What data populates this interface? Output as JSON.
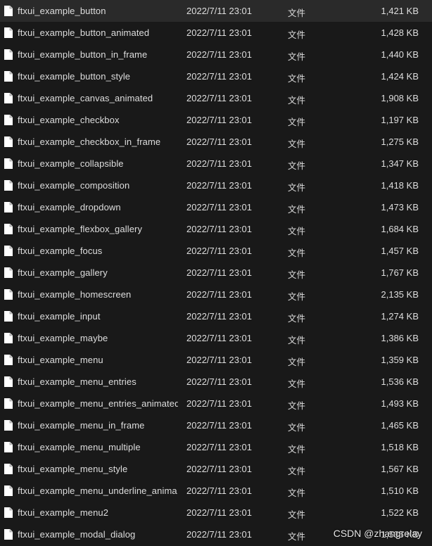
{
  "files": [
    {
      "name": "ftxui_example_button",
      "date": "2022/7/11 23:01",
      "type": "文件",
      "size": "1,421 KB"
    },
    {
      "name": "ftxui_example_button_animated",
      "date": "2022/7/11 23:01",
      "type": "文件",
      "size": "1,428 KB"
    },
    {
      "name": "ftxui_example_button_in_frame",
      "date": "2022/7/11 23:01",
      "type": "文件",
      "size": "1,440 KB"
    },
    {
      "name": "ftxui_example_button_style",
      "date": "2022/7/11 23:01",
      "type": "文件",
      "size": "1,424 KB"
    },
    {
      "name": "ftxui_example_canvas_animated",
      "date": "2022/7/11 23:01",
      "type": "文件",
      "size": "1,908 KB"
    },
    {
      "name": "ftxui_example_checkbox",
      "date": "2022/7/11 23:01",
      "type": "文件",
      "size": "1,197 KB"
    },
    {
      "name": "ftxui_example_checkbox_in_frame",
      "date": "2022/7/11 23:01",
      "type": "文件",
      "size": "1,275 KB"
    },
    {
      "name": "ftxui_example_collapsible",
      "date": "2022/7/11 23:01",
      "type": "文件",
      "size": "1,347 KB"
    },
    {
      "name": "ftxui_example_composition",
      "date": "2022/7/11 23:01",
      "type": "文件",
      "size": "1,418 KB"
    },
    {
      "name": "ftxui_example_dropdown",
      "date": "2022/7/11 23:01",
      "type": "文件",
      "size": "1,473 KB"
    },
    {
      "name": "ftxui_example_flexbox_gallery",
      "date": "2022/7/11 23:01",
      "type": "文件",
      "size": "1,684 KB"
    },
    {
      "name": "ftxui_example_focus",
      "date": "2022/7/11 23:01",
      "type": "文件",
      "size": "1,457 KB"
    },
    {
      "name": "ftxui_example_gallery",
      "date": "2022/7/11 23:01",
      "type": "文件",
      "size": "1,767 KB"
    },
    {
      "name": "ftxui_example_homescreen",
      "date": "2022/7/11 23:01",
      "type": "文件",
      "size": "2,135 KB"
    },
    {
      "name": "ftxui_example_input",
      "date": "2022/7/11 23:01",
      "type": "文件",
      "size": "1,274 KB"
    },
    {
      "name": "ftxui_example_maybe",
      "date": "2022/7/11 23:01",
      "type": "文件",
      "size": "1,386 KB"
    },
    {
      "name": "ftxui_example_menu",
      "date": "2022/7/11 23:01",
      "type": "文件",
      "size": "1,359 KB"
    },
    {
      "name": "ftxui_example_menu_entries",
      "date": "2022/7/11 23:01",
      "type": "文件",
      "size": "1,536 KB"
    },
    {
      "name": "ftxui_example_menu_entries_animated",
      "date": "2022/7/11 23:01",
      "type": "文件",
      "size": "1,493 KB"
    },
    {
      "name": "ftxui_example_menu_in_frame",
      "date": "2022/7/11 23:01",
      "type": "文件",
      "size": "1,465 KB"
    },
    {
      "name": "ftxui_example_menu_multiple",
      "date": "2022/7/11 23:01",
      "type": "文件",
      "size": "1,518 KB"
    },
    {
      "name": "ftxui_example_menu_style",
      "date": "2022/7/11 23:01",
      "type": "文件",
      "size": "1,567 KB"
    },
    {
      "name": "ftxui_example_menu_underline_anima...",
      "date": "2022/7/11 23:01",
      "type": "文件",
      "size": "1,510 KB"
    },
    {
      "name": "ftxui_example_menu2",
      "date": "2022/7/11 23:01",
      "type": "文件",
      "size": "1,522 KB"
    },
    {
      "name": "ftxui_example_modal_dialog",
      "date": "2022/7/11 23:01",
      "type": "文件",
      "size": "1,535 KB"
    }
  ],
  "icons": {
    "file": "file-icon"
  },
  "colors": {
    "background": "#191919",
    "text": "#dedede"
  },
  "watermark": "CSDN @zhangrelay"
}
